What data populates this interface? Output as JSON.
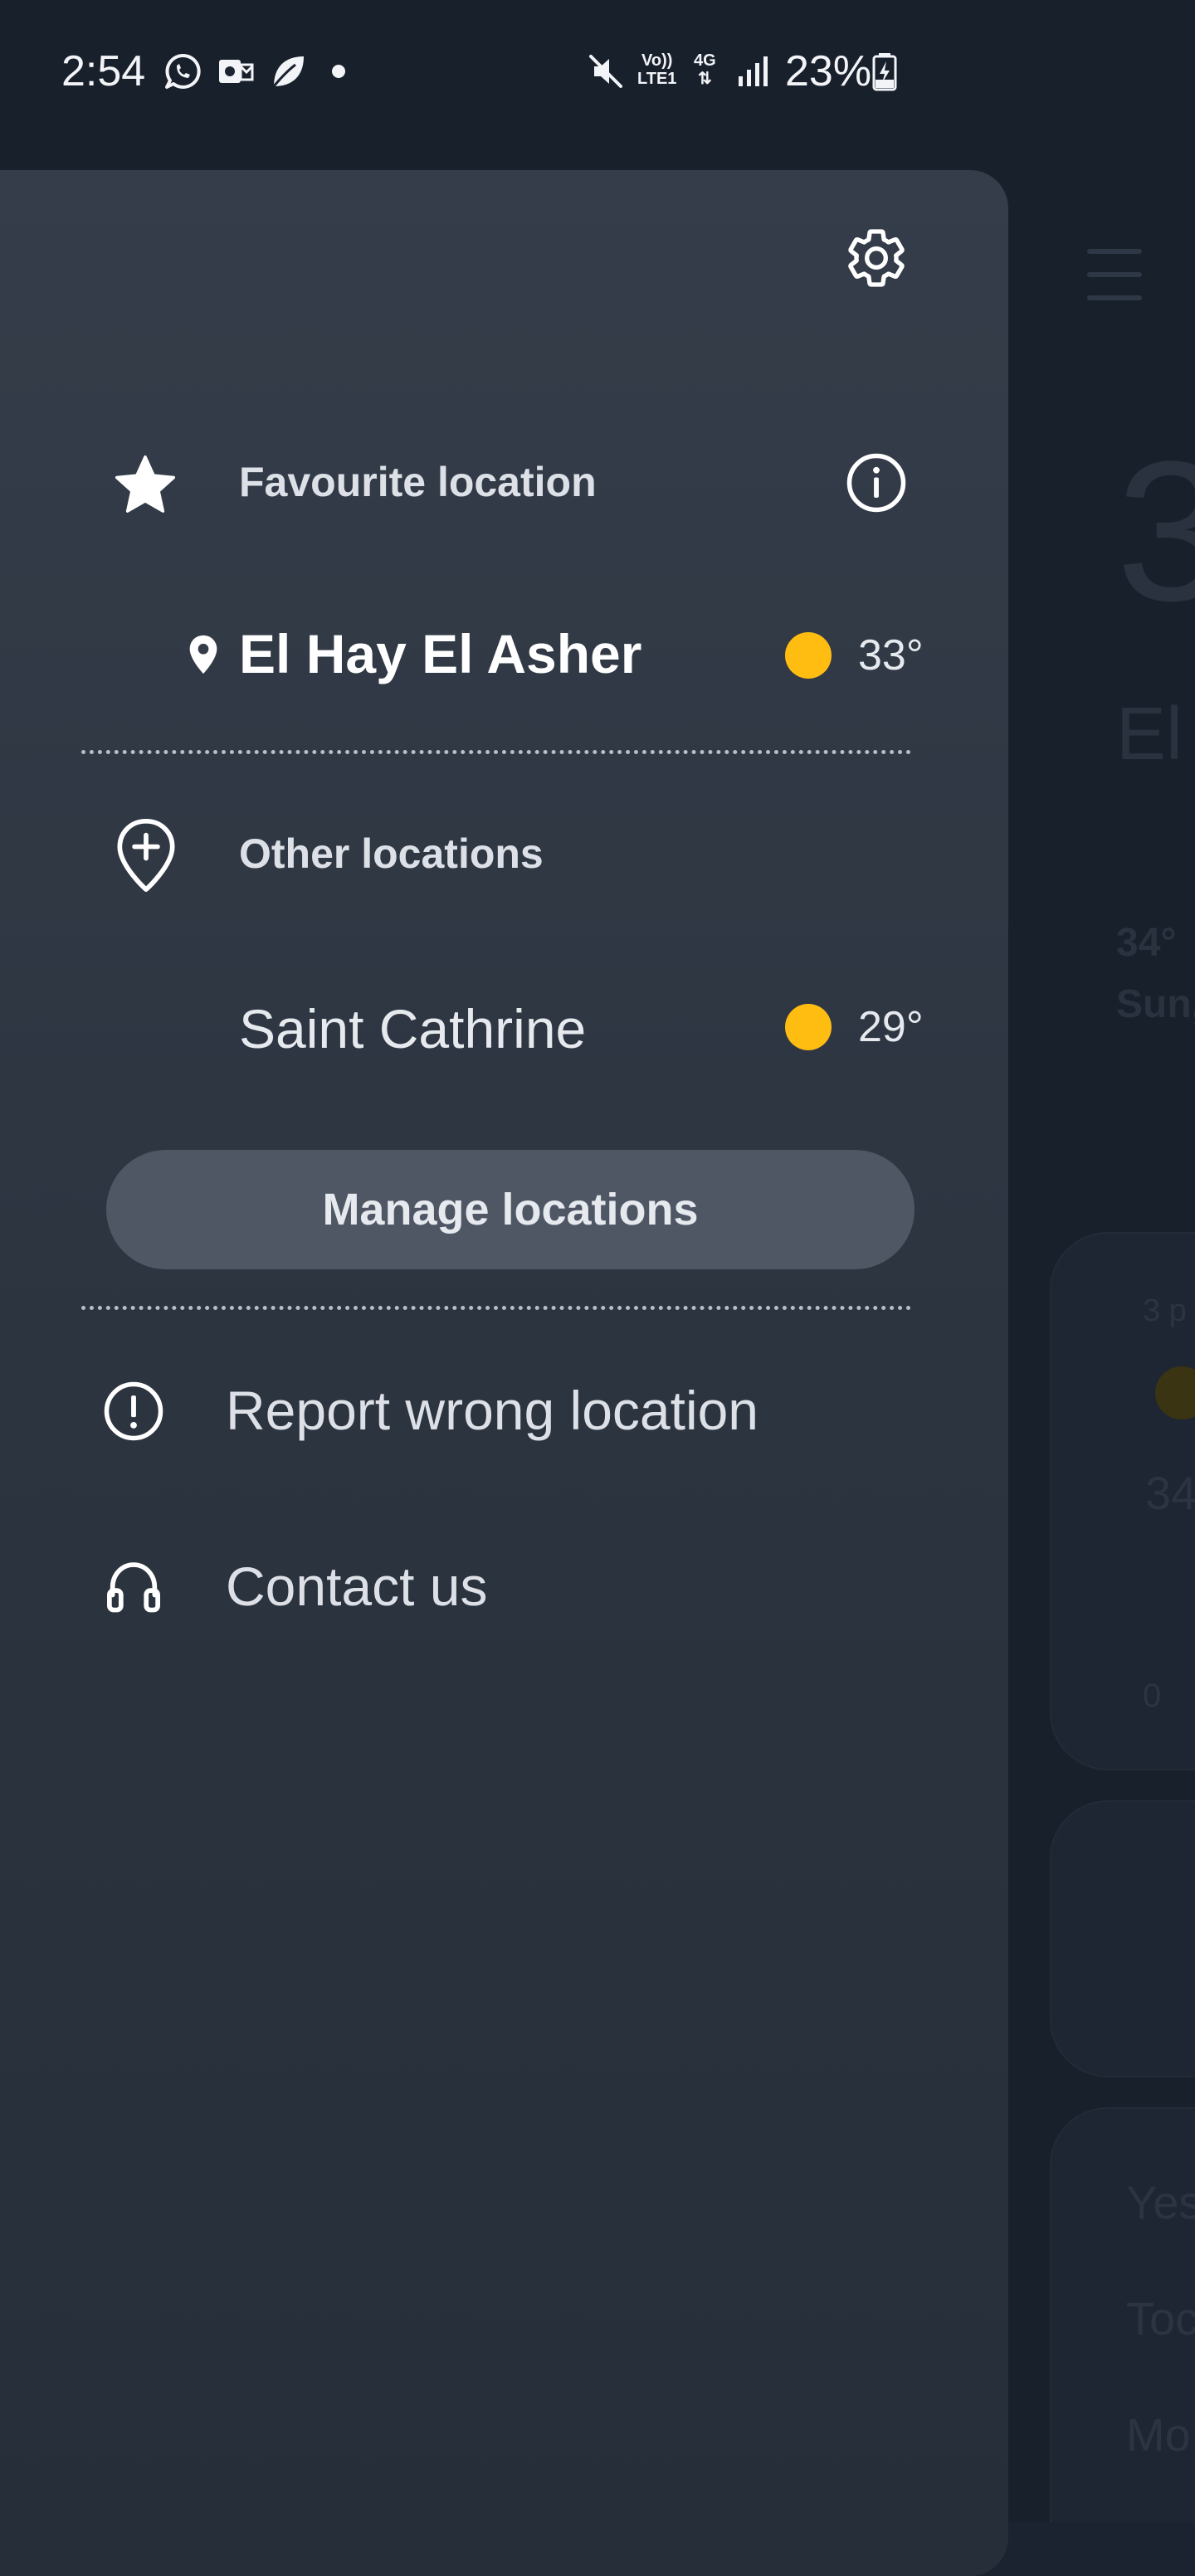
{
  "status_bar": {
    "time": "2:54",
    "network_top": "Vo))",
    "network_bottom": "LTE1",
    "data_type": "4G",
    "battery_percent": "23%",
    "icons": [
      "whatsapp-icon",
      "outlook-icon",
      "leaf-icon",
      "notification-dot",
      "mute-icon",
      "signal-icon",
      "battery-charging-icon"
    ]
  },
  "drawer": {
    "settings_icon": "gear-icon",
    "favourite": {
      "title": "Favourite location",
      "icon": "star-icon",
      "info_icon": "info-icon",
      "location": {
        "name": "El Hay El Asher",
        "temperature": "33°",
        "condition_icon": "sunny-icon",
        "pin_icon": "location-pin-icon"
      }
    },
    "other": {
      "title": "Other locations",
      "icon": "add-location-icon",
      "locations": [
        {
          "name": "Saint Cathrine",
          "temperature": "29°",
          "condition_icon": "sunny-icon"
        }
      ]
    },
    "manage_button": "Manage locations",
    "menu": [
      {
        "label": "Report wrong location",
        "icon": "alert-circle-icon"
      },
      {
        "label": "Contact us",
        "icon": "headset-icon"
      }
    ]
  },
  "background": {
    "current_temp": "3",
    "city": "El",
    "hi_lo": "34°",
    "date": "Sun,",
    "hourly_time": "3 p",
    "hourly_temp": "34",
    "precip": "0",
    "days": [
      "Yes",
      "Toc",
      "Mo"
    ]
  },
  "colors": {
    "drawer_bg": "#353d4a",
    "sun": "#ffbd12",
    "button_bg": "#4f5765",
    "app_bg": "#18202c"
  }
}
